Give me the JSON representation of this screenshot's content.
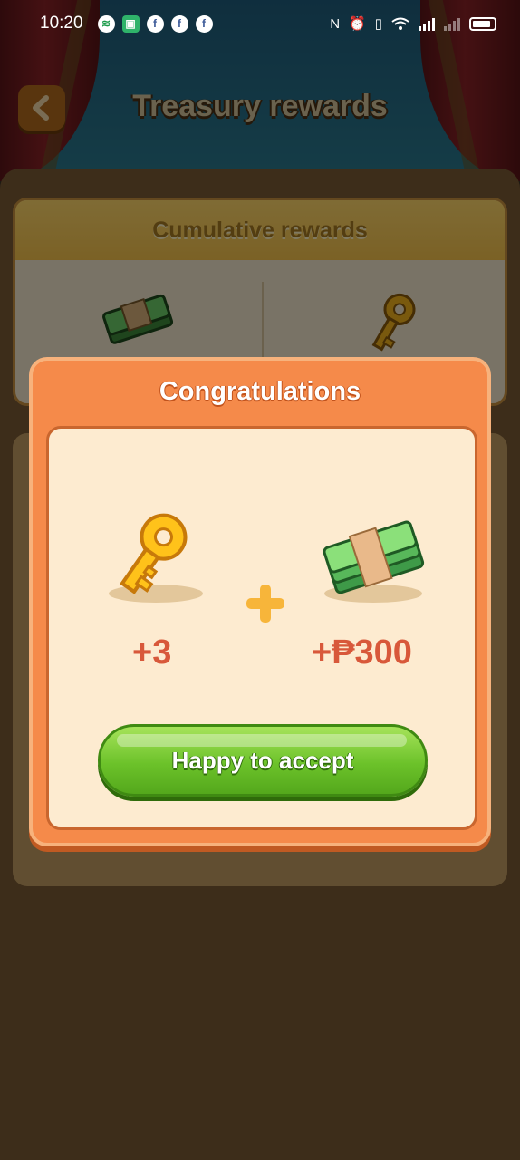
{
  "status_bar": {
    "time": "10:20",
    "notifications": [
      "spotify-icon",
      "app-icon",
      "facebook-icon",
      "facebook-icon",
      "facebook-icon"
    ],
    "right_icons": [
      "nfc-icon",
      "alarm-icon",
      "vibrate-icon",
      "wifi-icon",
      "signal-icon",
      "signal-icon",
      "battery-icon"
    ]
  },
  "header": {
    "title": "Treasury rewards",
    "back_icon": "chevron-left-icon"
  },
  "cumulative": {
    "heading": "Cumulative rewards",
    "icons": [
      "cash-stack-icon",
      "key-icon"
    ]
  },
  "modal": {
    "title": "Congratulations",
    "rewards": [
      {
        "icon": "key-icon",
        "amount": "+3"
      },
      {
        "icon": "cash-stack-icon",
        "amount": "+₱300"
      }
    ],
    "plus_icon": "plus-icon",
    "accept_label": "Happy to accept"
  },
  "colors": {
    "modal_orange": "#f58a4a",
    "amount_red": "#d8583a",
    "button_green": "#6cc22a"
  }
}
